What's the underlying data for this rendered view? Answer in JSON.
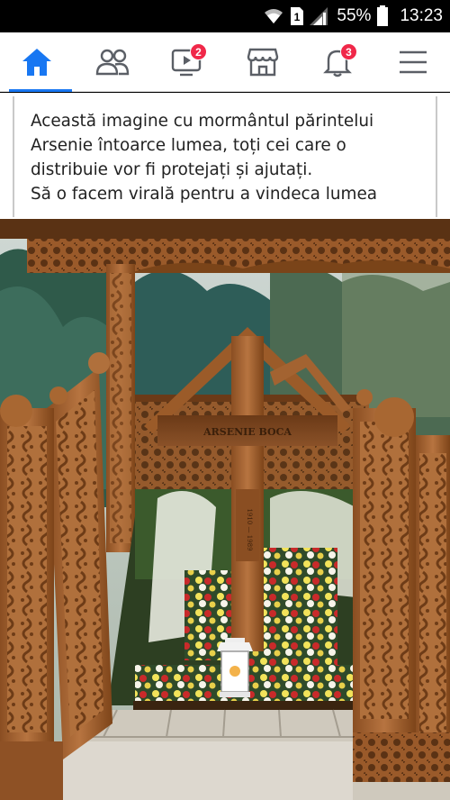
{
  "status_bar": {
    "battery": "55%",
    "time": "13:23",
    "sim": "1"
  },
  "nav": {
    "items": [
      {
        "name": "home",
        "icon": "home-icon",
        "active": true
      },
      {
        "name": "friends",
        "icon": "friends-icon"
      },
      {
        "name": "watch",
        "icon": "watch-icon",
        "badge": "2"
      },
      {
        "name": "marketplace",
        "icon": "marketplace-icon"
      },
      {
        "name": "notifications",
        "icon": "bell-icon",
        "badge": "3"
      },
      {
        "name": "menu",
        "icon": "menu-icon"
      }
    ],
    "accent": "#1877f2",
    "badge_color": "#f02849"
  },
  "post": {
    "lines": [
      "Această imagine cu mormântul părintelui",
      "Arsenie  întoarce lumea, toți cei care o",
      "distribuie vor fi protejați și ajutați.",
      "Să o facem virală pentru a vindeca lumea"
    ]
  },
  "photo": {
    "cross_inscription": "ARSENIE BOCA",
    "cross_years": "1910 — 1989"
  }
}
